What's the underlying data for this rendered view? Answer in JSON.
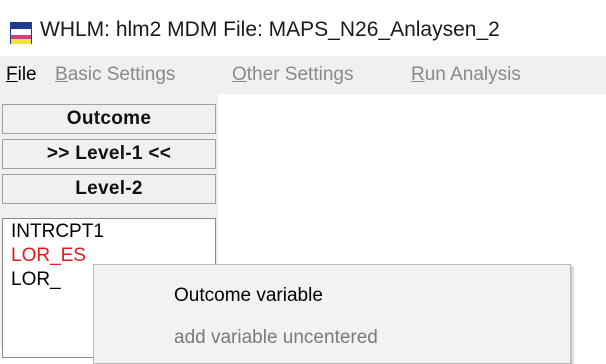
{
  "window": {
    "title": "WHLM: hlm2 MDM File: MAPS_N26_Anlaysen_2",
    "icon": "hlm-app-icon"
  },
  "menubar": {
    "file": {
      "accel": "F",
      "rest": "ile"
    },
    "basic_settings": {
      "accel": "B",
      "rest": "asic Settings"
    },
    "other_settings": {
      "accel": "O",
      "rest": "ther Settings"
    },
    "run_analysis": {
      "accel": "R",
      "rest": "un Analysis"
    }
  },
  "level_buttons": {
    "outcome": "Outcome",
    "level1": ">> Level-1 <<",
    "level2": "Level-2"
  },
  "variables": [
    {
      "label": "INTRCPT1",
      "color": "#000000"
    },
    {
      "label": "LOR_ES",
      "color": "#e01b1b"
    },
    {
      "label": "LOR_",
      "color": "#000000"
    }
  ],
  "context_menu": {
    "items": [
      {
        "label": "Outcome variable",
        "enabled": true
      },
      {
        "label": "add variable uncentered",
        "enabled": false
      }
    ]
  }
}
